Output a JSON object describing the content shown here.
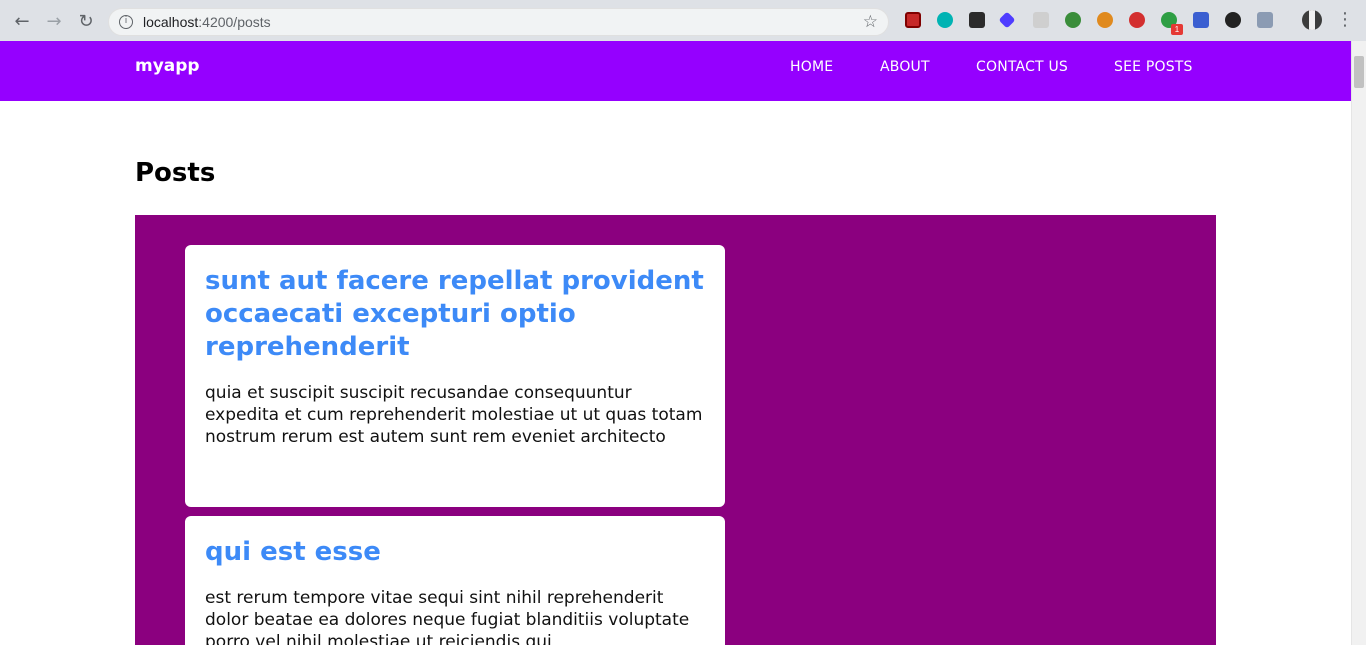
{
  "browser": {
    "url_host": "localhost",
    "url_path": ":4200/posts",
    "back_icon": "arrow-left",
    "forward_icon": "arrow-right",
    "reload_icon": "reload",
    "info_icon": "info",
    "star_icon": "star",
    "extension_badge": "1"
  },
  "navbar": {
    "brand": "myapp",
    "links": [
      "HOME",
      "ABOUT",
      "CONTACT US",
      "SEE POSTS"
    ],
    "background": "#9500ff"
  },
  "page": {
    "title": "Posts",
    "panel_color": "#8b007f",
    "title_color": "#3d8af7"
  },
  "posts": [
    {
      "title": "sunt aut facere repellat provident occaecati excepturi optio reprehenderit",
      "body": "quia et suscipit suscipit recusandae consequuntur expedita et cum reprehenderit molestiae ut ut quas totam nostrum rerum est autem sunt rem eveniet architecto"
    },
    {
      "title": "qui est esse",
      "body": "est rerum tempore vitae sequi sint nihil reprehenderit dolor beatae ea dolores neque fugiat blanditiis voluptate porro vel nihil molestiae ut reiciendis qui"
    }
  ]
}
